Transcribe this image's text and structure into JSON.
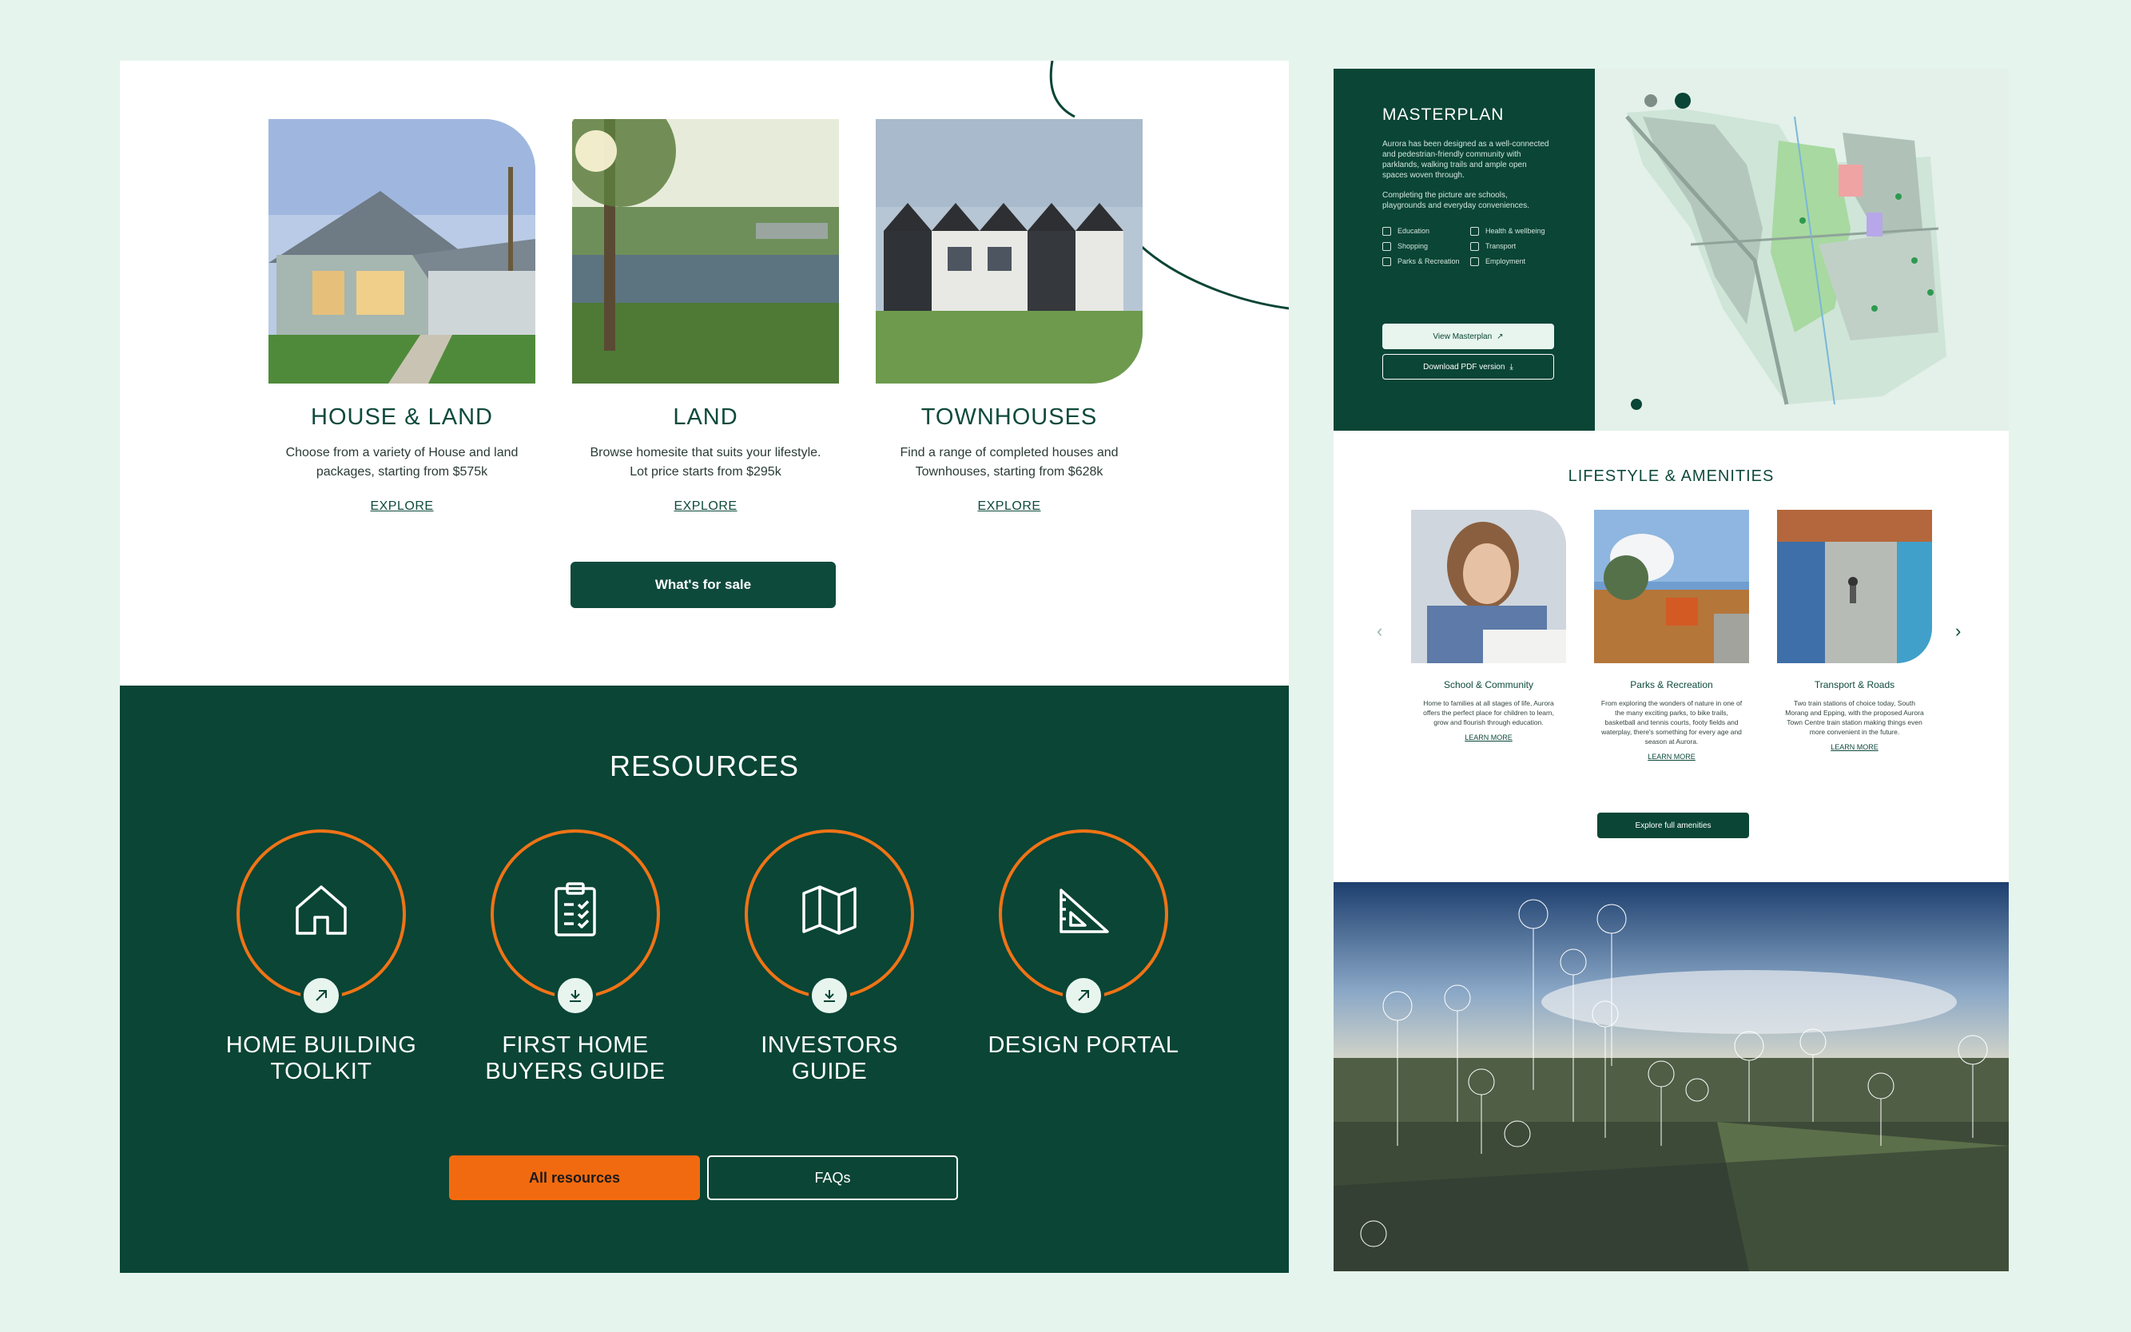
{
  "properties": [
    {
      "title": "HOUSE & LAND",
      "desc": "Choose from a variety of House and land packages, starting from $575k",
      "link": "EXPLORE"
    },
    {
      "title": "LAND",
      "desc": "Browse homesite that suits your lifestyle. Lot price starts from $295k",
      "link": "EXPLORE"
    },
    {
      "title": "TOWNHOUSES",
      "desc": "Find a range of completed houses and Townhouses, starting from $628k",
      "link": "EXPLORE"
    }
  ],
  "sale_button": "What's for sale",
  "resources": {
    "title": "RESOURCES",
    "items": [
      {
        "label": "HOME BUILDING TOOLKIT",
        "icon": "house-icon",
        "badge": "arrow-up-right-icon"
      },
      {
        "label": "FIRST HOME BUYERS GUIDE",
        "icon": "clipboard-checklist-icon",
        "badge": "download-icon"
      },
      {
        "label": "INVESTORS GUIDE",
        "icon": "map-icon",
        "badge": "download-icon"
      },
      {
        "label": "DESIGN PORTAL",
        "icon": "set-square-icon",
        "badge": "arrow-up-right-icon"
      }
    ],
    "primary_button": "All resources",
    "secondary_button": "FAQs"
  },
  "masterplan": {
    "title": "MASTERPLAN",
    "desc": "Aurora has been designed as a well-connected and pedestrian-friendly community with parklands, walking trails and ample open spaces woven through.",
    "desc2": "Completing the picture are schools, playgrounds and everyday conveniences.",
    "legend": [
      "Education",
      "Health & wellbeing",
      "Shopping",
      "Transport",
      "Parks & Recreation",
      "Employment"
    ],
    "view_button": "View Masterplan",
    "pdf_button": "Download PDF version"
  },
  "lifestyle": {
    "title": "LIFESTYLE & AMENITIES",
    "items": [
      {
        "title": "School & Community",
        "desc": "Home to families at all stages of life, Aurora offers the perfect place for children to learn, grow and flourish through education.",
        "link": "LEARN MORE"
      },
      {
        "title": "Parks & Recreation",
        "desc": "From exploring the wonders of nature in one of the many exciting parks, to bike trails, basketball and tennis courts, footy fields and waterplay, there's something for every age and season at Aurora.",
        "link": "LEARN MORE"
      },
      {
        "title": "Transport & Roads",
        "desc": "Two train stations of choice today, South Morang and Epping, with the proposed Aurora Town Centre train station making things even more convenient in the future.",
        "link": "LEARN MORE"
      }
    ],
    "button": "Explore full amenities"
  },
  "colors": {
    "brand_green": "#0a4535",
    "accent_orange": "#f26a0f",
    "mint_bg": "#e6f4ee"
  }
}
